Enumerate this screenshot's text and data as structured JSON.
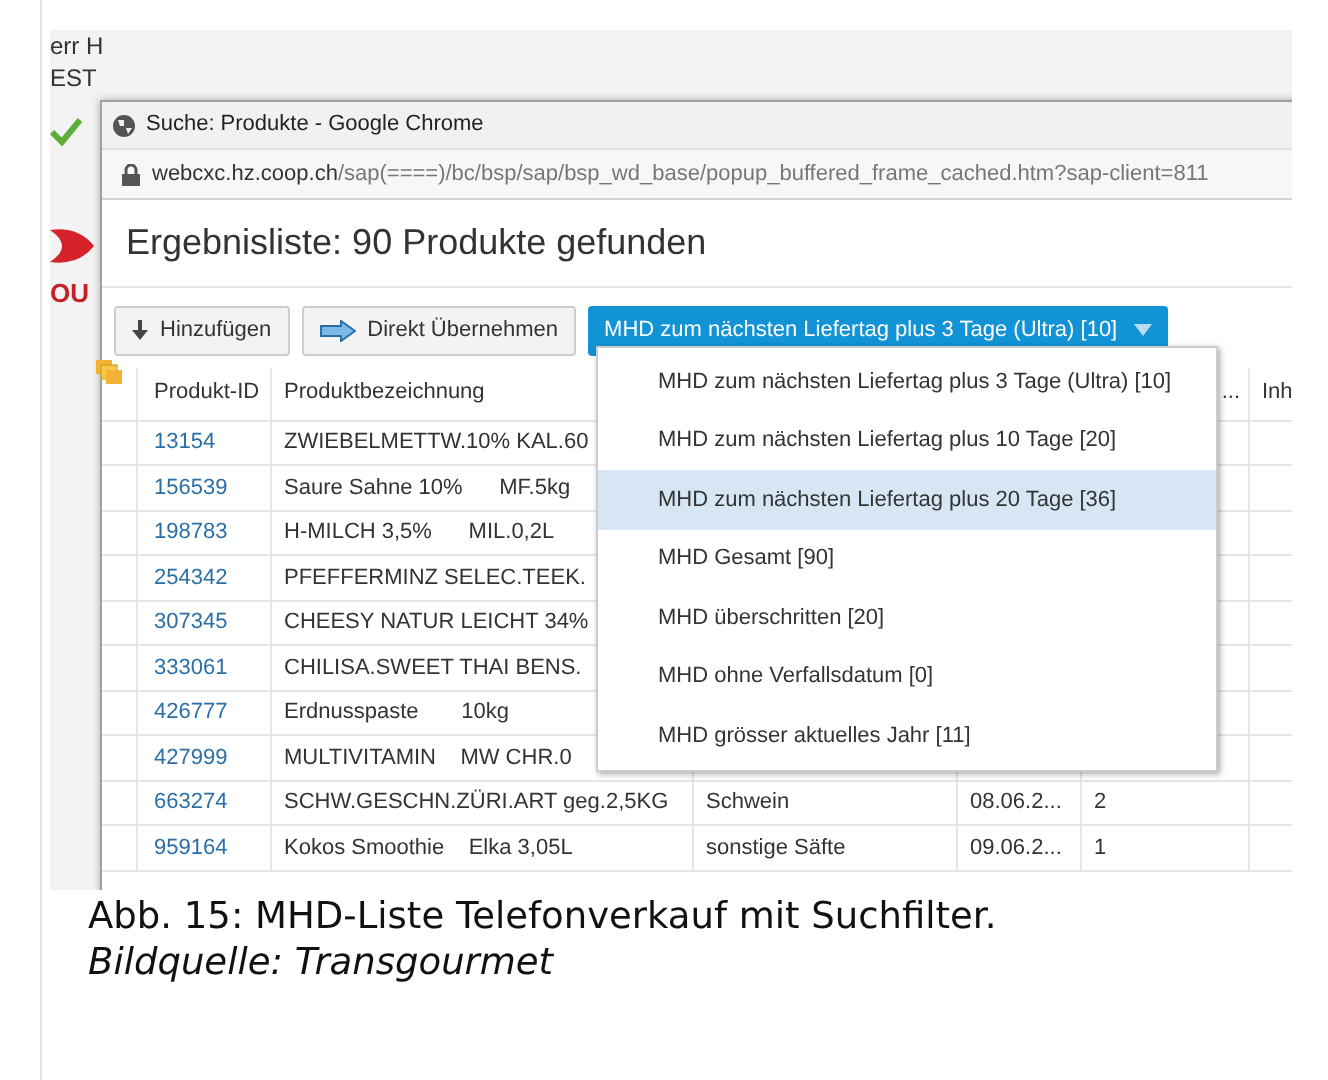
{
  "background_app": {
    "texts": [
      "err H",
      "EST"
    ],
    "brand_text": "OU"
  },
  "window": {
    "title": "Suche: Produkte - Google Chrome",
    "url_host": "webcxc.hz.coop.ch",
    "url_path": "/sap(====)/bc/bsp/sap/bsp_wd_base/popup_buffered_frame_cached.htm?sap-client=811"
  },
  "heading": "Ergebnisliste: 90 Produkte gefunden",
  "toolbar": [
    {
      "kind": "add",
      "label": "Hinzufügen"
    },
    {
      "kind": "transfer",
      "label": "Direkt Übernehmen"
    }
  ],
  "filter": {
    "label": "MHD zum nächsten Liefertag plus 3 Tage (Ultra) [10]",
    "expanded": true,
    "options": [
      {
        "label": "MHD zum nächsten Liefertag plus 3 Tage (Ultra) [10]",
        "selected": false
      },
      {
        "label": "MHD zum nächsten Liefertag plus 10 Tage [20]",
        "selected": false
      },
      {
        "label": "MHD zum nächsten Liefertag plus 20 Tage [36]",
        "selected": true
      },
      {
        "label": "MHD Gesamt [90]",
        "selected": false
      },
      {
        "label": "MHD überschritten [20]",
        "selected": false
      },
      {
        "label": "MHD ohne Verfallsdatum [0]",
        "selected": false
      },
      {
        "label": "MHD grösser aktuelles Jahr [11]",
        "selected": false
      }
    ]
  },
  "table": {
    "header": {
      "id": "Produkt-ID",
      "name": "Produktbezeichnung",
      "column_5": "...",
      "column_6": "Inh"
    },
    "rows": [
      {
        "id": "13154",
        "name": "ZWIEBELMETTW.10% KAL.60"
      },
      {
        "id": "156539",
        "name": "Saure Sahne 10%      MF.5kg"
      },
      {
        "id": "198783",
        "name": "H-MILCH 3,5%      MIL.0,2L"
      },
      {
        "id": "254342",
        "name": "PFEFFERMINZ SELEC.TEEK."
      },
      {
        "id": "307345",
        "name": "CHEESY NATUR LEICHT 34%"
      },
      {
        "id": "333061",
        "name": "CHILISA.SWEET THAI BENS."
      },
      {
        "id": "426777",
        "name": "Erdnusspaste       10kg"
      },
      {
        "id": "427999",
        "name": "MULTIVITAMIN    MW CHR.0"
      },
      {
        "id": "663274",
        "name": "SCHW.GESCHN.ZÜRI.ART geg.2,5KG",
        "column_3": "Schwein",
        "column_4": "08.06.2...",
        "column_5": "2"
      },
      {
        "id": "959164",
        "name": "Kokos Smoothie    Elka 3,05L",
        "column_3": "sonstige Säfte",
        "column_4": "09.06.2...",
        "column_5": "1"
      }
    ]
  },
  "caption": {
    "text": "Abb. 15: MHD-Liste Telefonverkauf mit Suchfilter.",
    "source": "Bildquelle: Transgourmet"
  }
}
